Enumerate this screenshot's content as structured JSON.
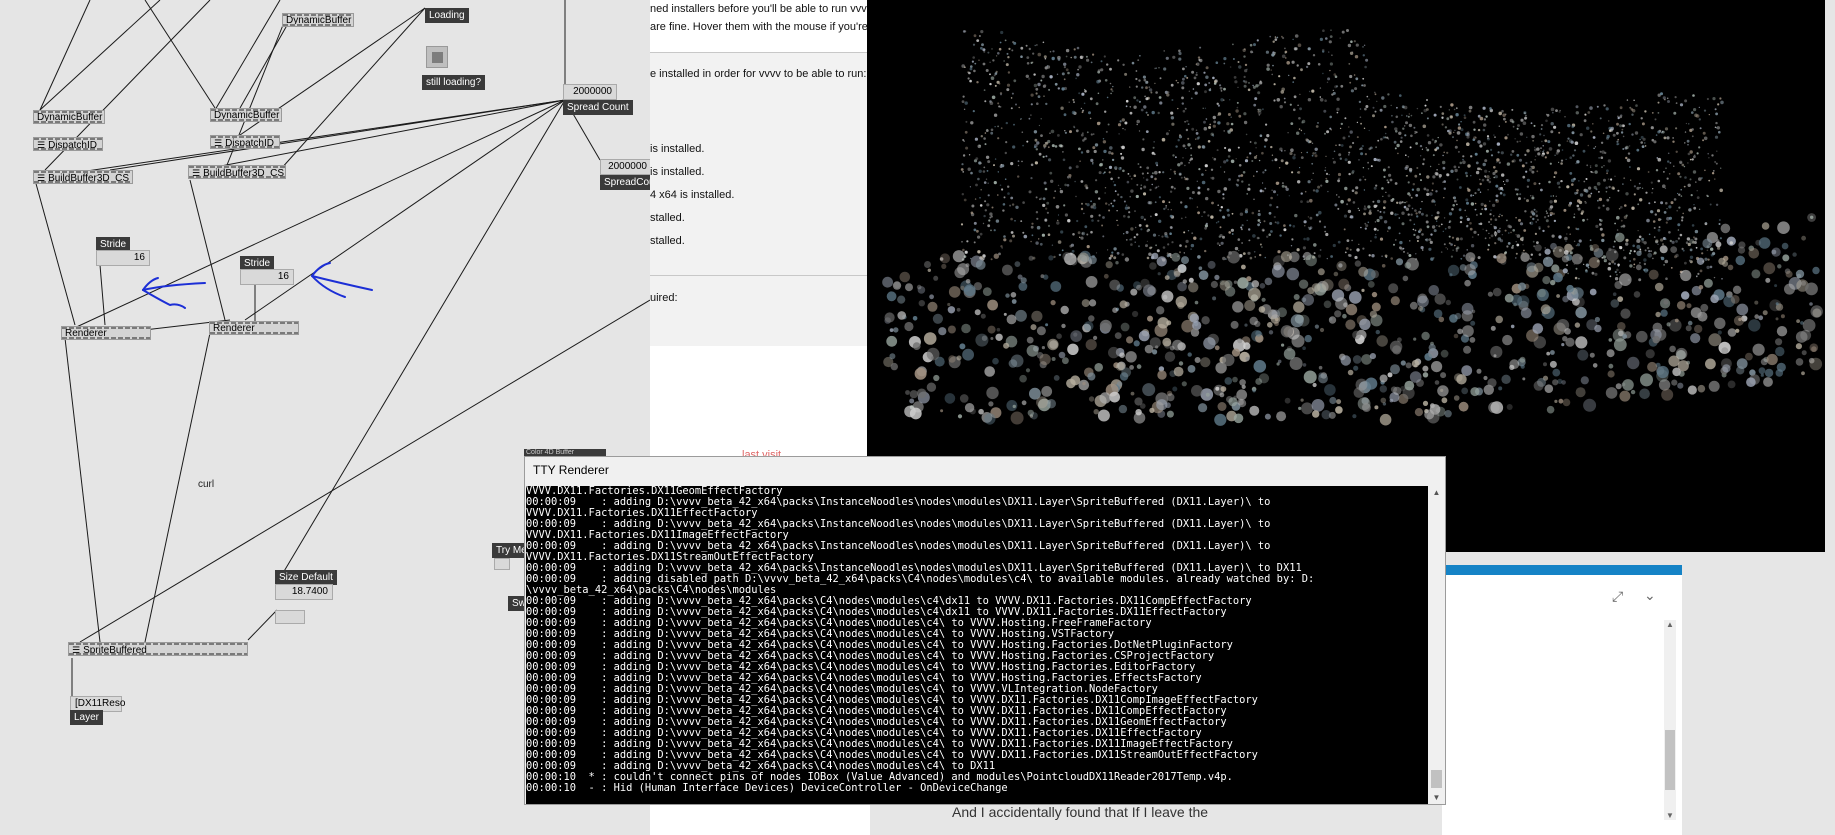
{
  "patch": {
    "nodes": {
      "dynamic_buffer_top": "DynamicBuffer",
      "dynamic_buffer_left": "DynamicBuffer",
      "dynamic_buffer_mid": "DynamicBuffer",
      "dispatch_left": "DispatchID",
      "dispatch_mid": "DispatchID",
      "build_left": "BuildBuffer3D_CS",
      "build_mid": "BuildBuffer3D_CS",
      "renderer_left": "Renderer",
      "renderer_mid": "Renderer",
      "sprite": "SpriteBuffered"
    },
    "loading_label": "Loading",
    "still_loading": "still loading?",
    "spread_value": "2000000",
    "spread_label": "Spread Count",
    "spread2_value": "2000000",
    "spread2_label": "SpreadCou",
    "stride1_label": "Stride",
    "stride1_value": "16",
    "stride2_label": "Stride",
    "stride2_value": "16",
    "curl": "curl",
    "size_default_label": "Size Default",
    "size_default_value": "18.7400",
    "dx11_reso": "[DX11Reso",
    "layer_label": "Layer",
    "try_me": "Try Me",
    "sw": "Sw"
  },
  "webpage": {
    "line1": "ned installers before you'll be able to run vvvv",
    "line2": "are fine. Hover them with the mouse if you're",
    "line3": "e installed in order for vvvv to be able to run:",
    "item1": "is installed.",
    "item2": "is installed.",
    "item3": "4 x64 is installed.",
    "item4": "stalled.",
    "item5": "stalled.",
    "required": "uired:",
    "red_text": "last visit"
  },
  "strip_text": "Color 4D Buffer",
  "tty": {
    "title": "TTY Renderer",
    "lines": [
      "VVVV.DX11.Factories.DX11GeomEffectFactory",
      "00:00:09    : adding D:\\vvvv_beta_42_x64\\packs\\InstanceNoodles\\nodes\\modules\\DX11.Layer\\SpriteBuffered (DX11.Layer)\\ to",
      "VVVV.DX11.Factories.DX11EffectFactory",
      "00:00:09    : adding D:\\vvvv_beta_42_x64\\packs\\InstanceNoodles\\nodes\\modules\\DX11.Layer\\SpriteBuffered (DX11.Layer)\\ to",
      "VVVV.DX11.Factories.DX11ImageEffectFactory",
      "00:00:09    : adding D:\\vvvv_beta_42_x64\\packs\\InstanceNoodles\\nodes\\modules\\DX11.Layer\\SpriteBuffered (DX11.Layer)\\ to",
      "VVVV.DX11.Factories.DX11StreamOutEffectFactory",
      "00:00:09    : adding D:\\vvvv_beta_42_x64\\packs\\InstanceNoodles\\nodes\\modules\\DX11.Layer\\SpriteBuffered (DX11.Layer)\\ to DX11",
      "00:00:09    : adding disabled path D:\\vvvv_beta_42_x64\\packs\\C4\\nodes\\modules\\c4\\ to available modules. already watched by: D:",
      "\\vvvv_beta_42_x64\\packs\\C4\\nodes\\modules",
      "00:00:09    : adding D:\\vvvv_beta_42_x64\\packs\\C4\\nodes\\modules\\c4\\dx11 to VVVV.DX11.Factories.DX11CompEffectFactory",
      "00:00:09    : adding D:\\vvvv_beta_42_x64\\packs\\C4\\nodes\\modules\\c4\\dx11 to VVVV.DX11.Factories.DX11EffectFactory",
      "00:00:09    : adding D:\\vvvv_beta_42_x64\\packs\\C4\\nodes\\modules\\c4\\ to VVVV.Hosting.FreeFrameFactory",
      "00:00:09    : adding D:\\vvvv_beta_42_x64\\packs\\C4\\nodes\\modules\\c4\\ to VVVV.Hosting.VSTFactory",
      "00:00:09    : adding D:\\vvvv_beta_42_x64\\packs\\C4\\nodes\\modules\\c4\\ to VVVV.Hosting.Factories.DotNetPluginFactory",
      "00:00:09    : adding D:\\vvvv_beta_42_x64\\packs\\C4\\nodes\\modules\\c4\\ to VVVV.Hosting.Factories.CSProjectFactory",
      "00:00:09    : adding D:\\vvvv_beta_42_x64\\packs\\C4\\nodes\\modules\\c4\\ to VVVV.Hosting.Factories.EditorFactory",
      "00:00:09    : adding D:\\vvvv_beta_42_x64\\packs\\C4\\nodes\\modules\\c4\\ to VVVV.Hosting.Factories.EffectsFactory",
      "00:00:09    : adding D:\\vvvv_beta_42_x64\\packs\\C4\\nodes\\modules\\c4\\ to VVVV.VLIntegration.NodeFactory",
      "00:00:09    : adding D:\\vvvv_beta_42_x64\\packs\\C4\\nodes\\modules\\c4\\ to VVVV.DX11.Factories.DX11CompImageEffectFactory",
      "00:00:09    : adding D:\\vvvv_beta_42_x64\\packs\\C4\\nodes\\modules\\c4\\ to VVVV.DX11.Factories.DX11CompEffectFactory",
      "00:00:09    : adding D:\\vvvv_beta_42_x64\\packs\\C4\\nodes\\modules\\c4\\ to VVVV.DX11.Factories.DX11GeomEffectFactory",
      "00:00:09    : adding D:\\vvvv_beta_42_x64\\packs\\C4\\nodes\\modules\\c4\\ to VVVV.DX11.Factories.DX11EffectFactory",
      "00:00:09    : adding D:\\vvvv_beta_42_x64\\packs\\C4\\nodes\\modules\\c4\\ to VVVV.DX11.Factories.DX11ImageEffectFactory",
      "00:00:09    : adding D:\\vvvv_beta_42_x64\\packs\\C4\\nodes\\modules\\c4\\ to VVVV.DX11.Factories.DX11StreamOutEffectFactory",
      "00:00:09    : adding D:\\vvvv_beta_42_x64\\packs\\C4\\nodes\\modules\\c4\\ to DX11",
      "00:00:10  * : couldn't connect pins of nodes IOBox (Value Advanced) and modules\\PointcloudDX11Reader2017Temp.v4p.",
      "00:00:10  - : Hid (Human Interface Devices) DeviceController - OnDeviceChange"
    ]
  },
  "bottom_text": "And I accidentally found that If I leave the",
  "icons": {
    "expand": "expand-icon",
    "chevron": "chevron-down-icon"
  }
}
